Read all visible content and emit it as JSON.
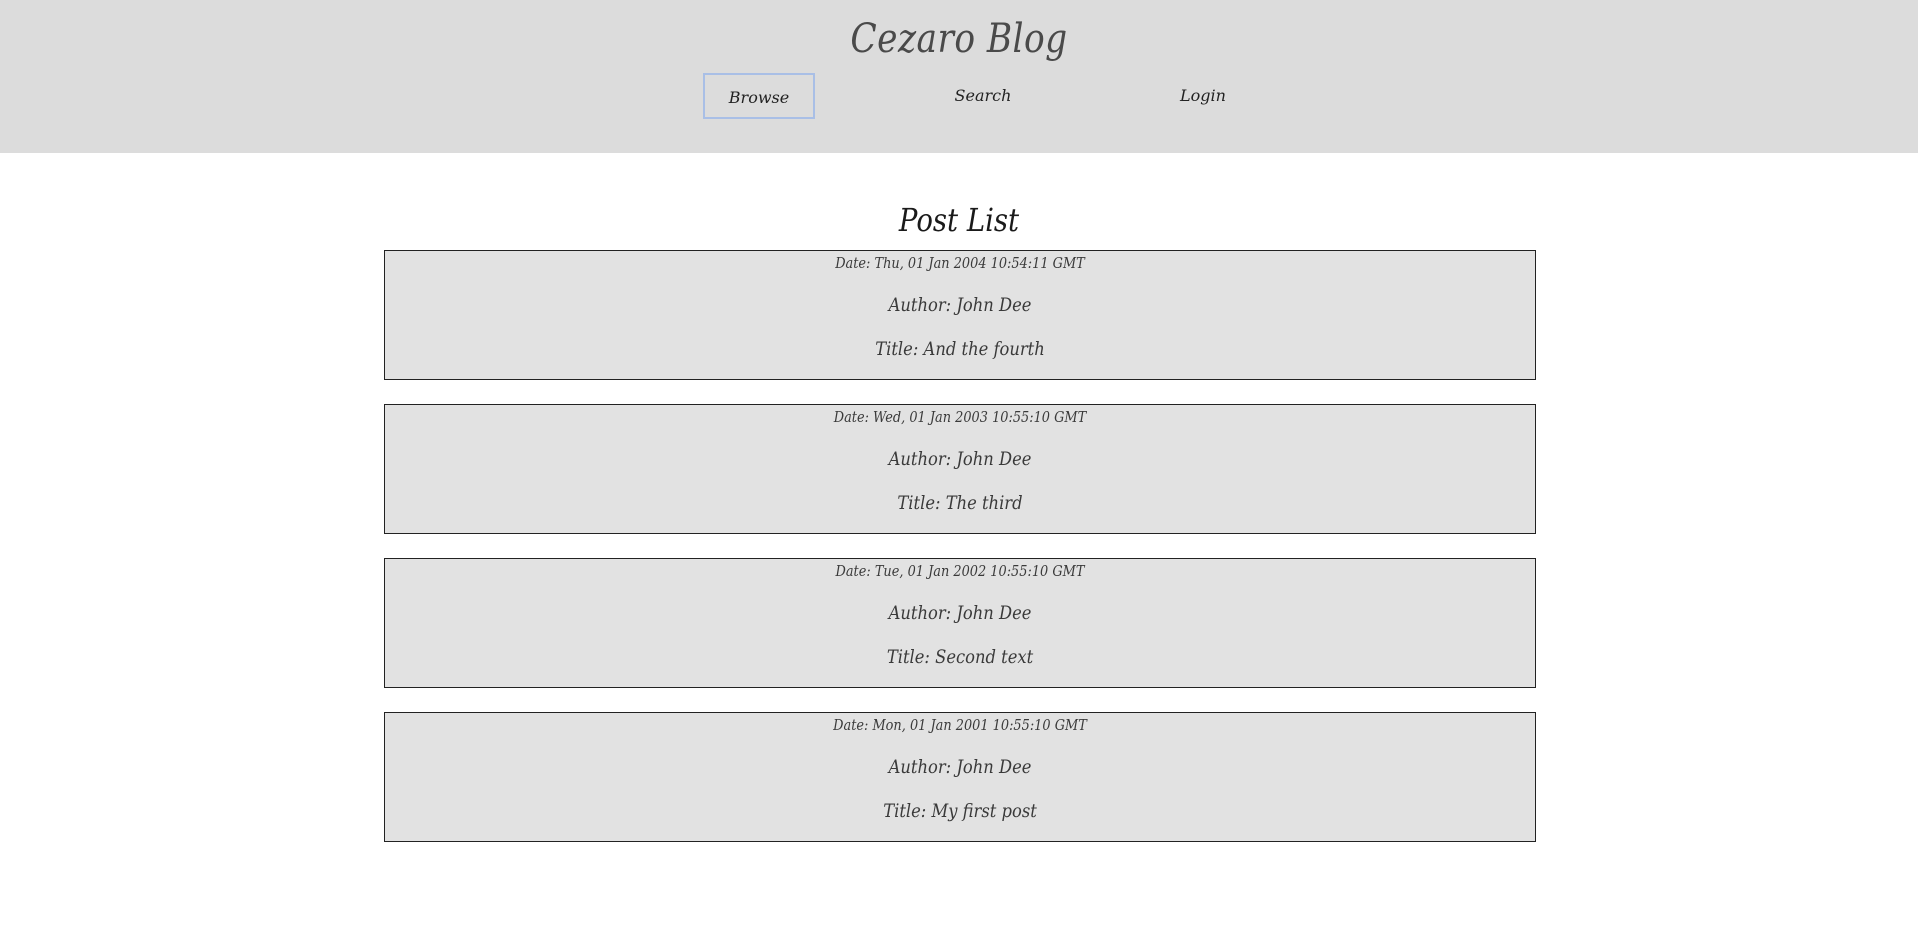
{
  "header": {
    "site_title": "Cezaro Blog",
    "nav": {
      "browse": "Browse",
      "search": "Search",
      "login": "Login"
    }
  },
  "main": {
    "list_title": "Post List",
    "posts": [
      {
        "date": "Date: Thu, 01 Jan 2004 10:54:11 GMT",
        "author": "Author: John Dee",
        "title": "Title: And the fourth"
      },
      {
        "date": "Date: Wed, 01 Jan 2003 10:55:10 GMT",
        "author": "Author: John Dee",
        "title": "Title: The third"
      },
      {
        "date": "Date: Tue, 01 Jan 2002 10:55:10 GMT",
        "author": "Author: John Dee",
        "title": "Title: Second text"
      },
      {
        "date": "Date: Mon, 01 Jan 2001 10:55:10 GMT",
        "author": "Author: John Dee",
        "title": "Title: My first post"
      }
    ]
  },
  "colors": {
    "header_bg": "#dcdcdc",
    "post_bg": "#e2e2e2",
    "focus_border": "#a9bfe6"
  }
}
